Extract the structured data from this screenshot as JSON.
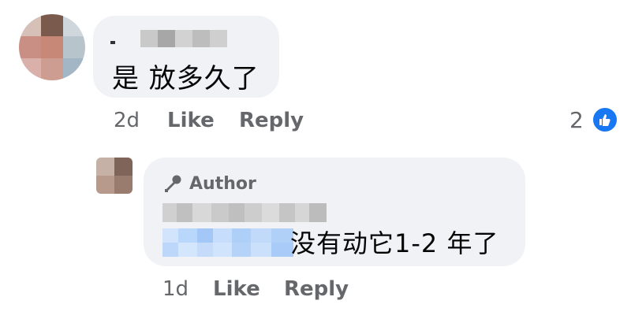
{
  "comment": {
    "text": "是 放多久了",
    "time": "2d",
    "like_label": "Like",
    "reply_label": "Reply",
    "reaction_count": "2",
    "reaction_icon": "thumbs-up-icon",
    "reaction_color": "#1877f2"
  },
  "reply": {
    "author_badge": "Author",
    "badge_icon": "microphone-icon",
    "text": "没有动它1-2 年了",
    "time": "1d",
    "like_label": "Like",
    "reply_label": "Reply"
  },
  "colors": {
    "bubble": "#f0f2f5",
    "muted_text": "#65676b",
    "primary_text": "#050505"
  }
}
